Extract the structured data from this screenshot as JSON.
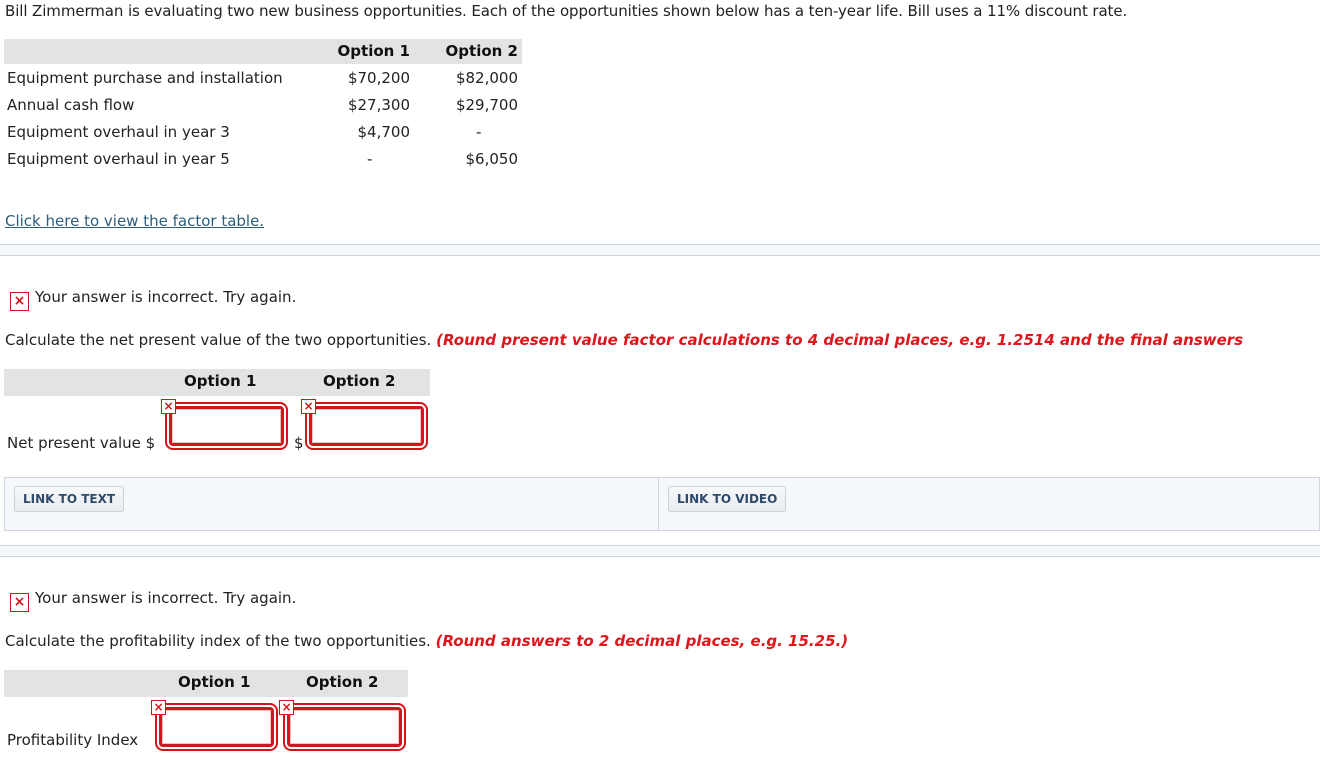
{
  "problem": {
    "intro": "Bill Zimmerman is evaluating two new business opportunities. Each of the opportunities shown below has a ten-year life. Bill uses a 11% discount rate.",
    "table": {
      "headers": [
        "",
        "Option 1",
        "Option 2"
      ],
      "rows": [
        {
          "label": "Equipment purchase and installation",
          "option1": "$70,200",
          "option2": "$82,000"
        },
        {
          "label": "Annual cash flow",
          "option1": "$27,300",
          "option2": "$29,700"
        },
        {
          "label": "Equipment overhaul in year 3",
          "option1": "$4,700",
          "option2": "-"
        },
        {
          "label": "Equipment overhaul in year 5",
          "option1": "-",
          "option2": "$6,050"
        }
      ]
    },
    "factor_link": "Click here to view the factor table."
  },
  "part_npv": {
    "feedback": "Your answer is incorrect.  Try again.",
    "instruction": "Calculate the net present value of the two opportunities.",
    "hint": "(Round present value factor calculations to 4 decimal places, e.g. 1.2514 and the final answers",
    "headers": [
      "Option 1",
      "Option 2"
    ],
    "row_label": "Net present value $",
    "currency": "$",
    "option1_value": "",
    "option2_value": ""
  },
  "links": {
    "text_label": "LINK TO TEXT",
    "video_label": "LINK TO VIDEO"
  },
  "part_pi": {
    "feedback": "Your answer is incorrect.  Try again.",
    "instruction": "Calculate the profitability index of the two opportunities.",
    "hint": "(Round answers to 2 decimal places, e.g. 15.25.)",
    "headers": [
      "Option 1",
      "Option 2"
    ],
    "row_label": "Profitability Index",
    "option1_value": "",
    "option2_value": ""
  },
  "icons": {
    "incorrect": "×"
  },
  "colors": {
    "error_red": "#e0141b",
    "link_blue": "#2c5d7c",
    "header_gray": "#e3e3e3"
  }
}
